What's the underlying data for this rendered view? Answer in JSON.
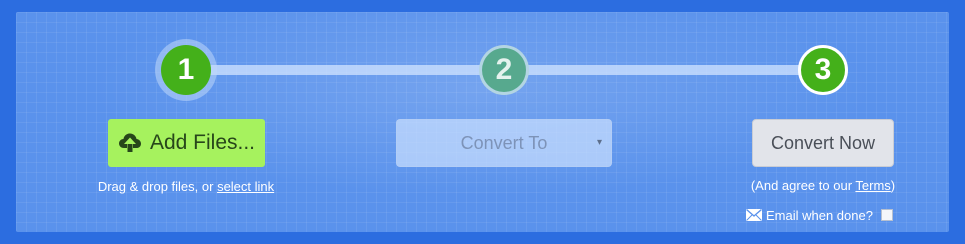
{
  "steps": [
    {
      "number": "1",
      "state": "active"
    },
    {
      "number": "2",
      "state": "inactive"
    },
    {
      "number": "3",
      "state": "active"
    }
  ],
  "upload": {
    "button_label": "Add Files...",
    "icon": "cloud-upload-icon",
    "hint_prefix": "Drag & drop files, or ",
    "hint_link": "select link"
  },
  "convert": {
    "selected": "Convert To",
    "caret": "▾"
  },
  "convert_now": {
    "button_label": "Convert Now",
    "agree_open": "(And agree to our ",
    "terms_link": "Terms",
    "agree_close": ")",
    "email_label": "Email when done?",
    "email_icon": "envelope-icon",
    "email_checked": false
  },
  "colors": {
    "background": "#2c6de0",
    "panel": "#5a92ec",
    "step_green": "#44b01a",
    "add_files_green": "#a6f25e",
    "convert_now_gray": "#e2e4ea"
  }
}
